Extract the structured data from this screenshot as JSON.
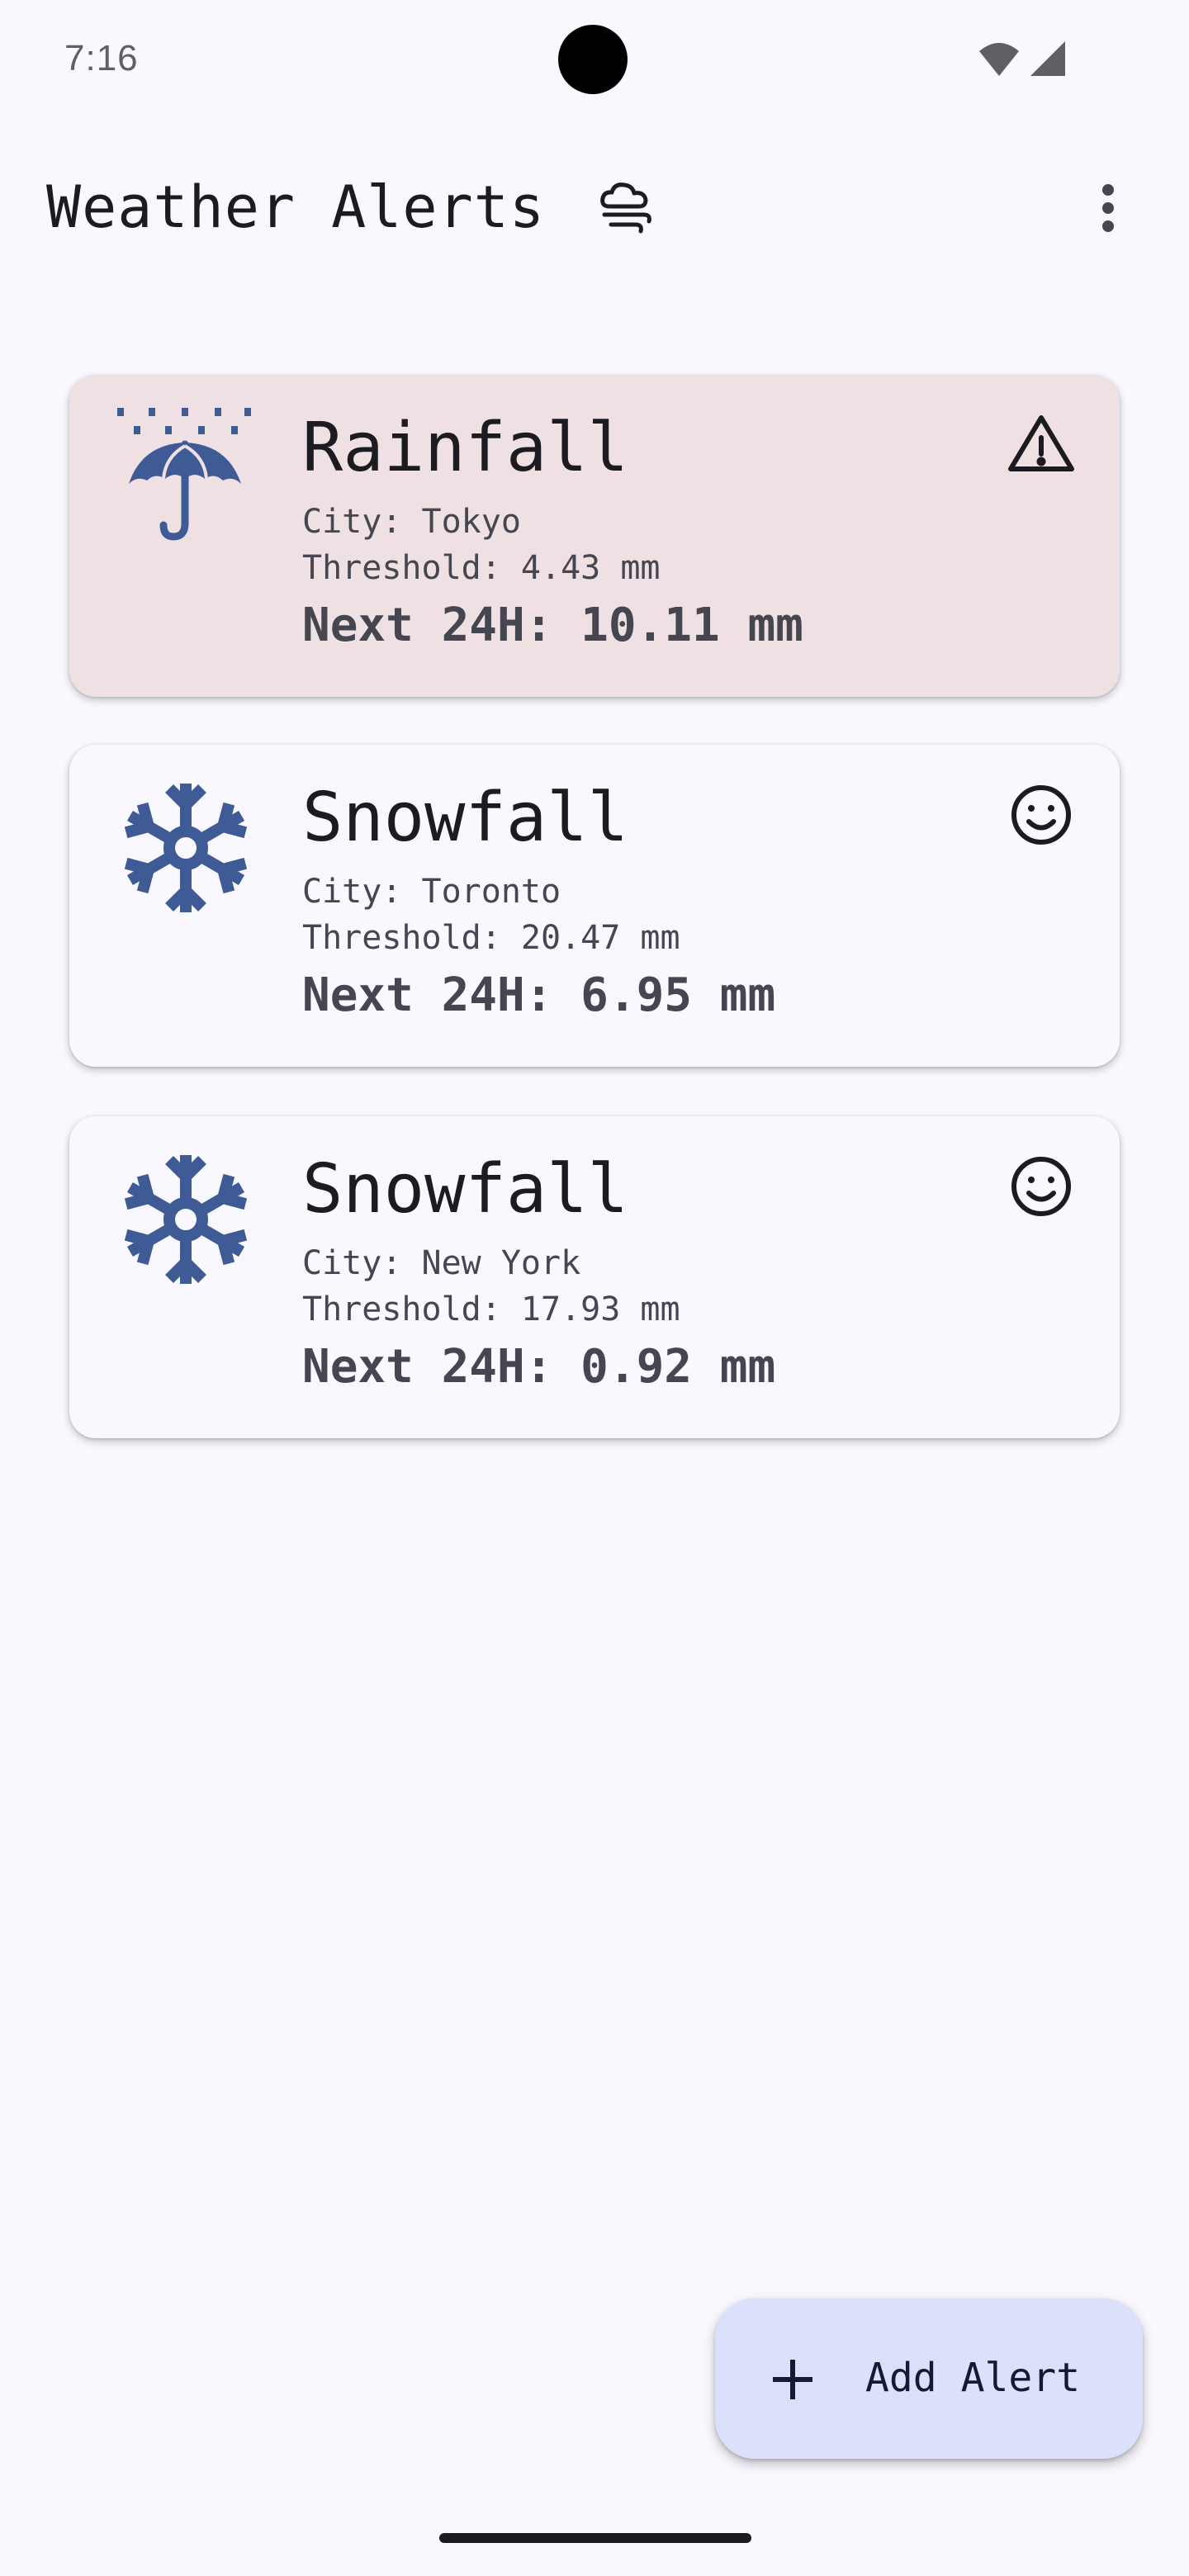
{
  "status_bar": {
    "time": "7:16",
    "icons": [
      "wifi-icon",
      "cellular-signal-icon"
    ]
  },
  "app_bar": {
    "title": "Weather Alerts",
    "title_icon": "storm-cloud-icon",
    "menu_icon": "more-vert-icon"
  },
  "alerts": [
    {
      "type": "Rainfall",
      "city": "City: Tokyo",
      "threshold": "Threshold: 4.43 mm",
      "next": "Next 24H: 10.11 mm",
      "icon": "umbrella-rain-icon",
      "status_icon": "warning-icon",
      "triggered": true
    },
    {
      "type": "Snowfall",
      "city": "City: Toronto",
      "threshold": "Threshold: 20.47 mm",
      "next": "Next 24H: 6.95 mm",
      "icon": "snowflake-icon",
      "status_icon": "smiley-face-icon",
      "triggered": false
    },
    {
      "type": "Snowfall",
      "city": "City: New York",
      "threshold": "Threshold: 17.93 mm",
      "next": "Next 24H: 0.92 mm",
      "icon": "snowflake-icon",
      "status_icon": "smiley-face-icon",
      "triggered": false
    }
  ],
  "fab": {
    "label": "Add Alert",
    "icon": "plus-icon"
  },
  "colors": {
    "background": "#f9f8fe",
    "alert_card": "#efe1e3",
    "icon_blue": "#3f5b96",
    "fab": "#dce1fb"
  }
}
